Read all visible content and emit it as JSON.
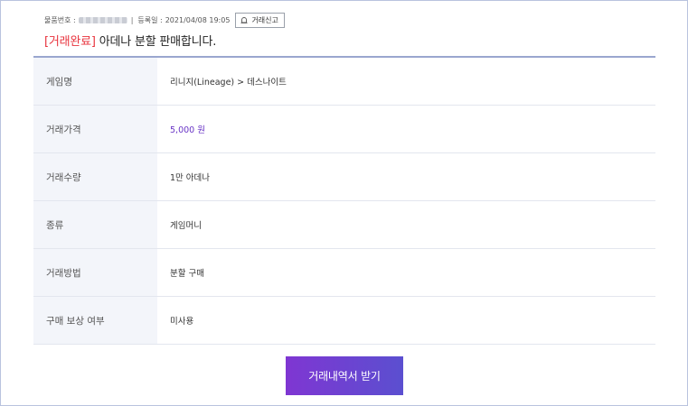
{
  "meta": {
    "item_no_label": "물품번호 :",
    "separator": "|",
    "reg_date_label": "등록일 :",
    "reg_date": "2021/04/08 19:05",
    "report_label": "거래신고"
  },
  "title": {
    "status": "[거래완료]",
    "text": "아데나 분할 판매합니다."
  },
  "details": [
    {
      "label": "게임명",
      "value": "리니지(Lineage) > 데스나이트"
    },
    {
      "label": "거래가격",
      "value": "5,000 원"
    },
    {
      "label": "거래수량",
      "value": "1만 아데나"
    },
    {
      "label": "종류",
      "value": "게임머니"
    },
    {
      "label": "거래방법",
      "value": "분할 구매"
    },
    {
      "label": "구매 보상 여부",
      "value": "미사용"
    }
  ],
  "cta_label": "거래내역서 받기",
  "colors": {
    "status": "#e8323c",
    "price": "#6a36c6",
    "button_gradient_start": "#7f36d2",
    "button_gradient_end": "#5b4fd0"
  },
  "icons": {
    "report": "siren-icon"
  }
}
